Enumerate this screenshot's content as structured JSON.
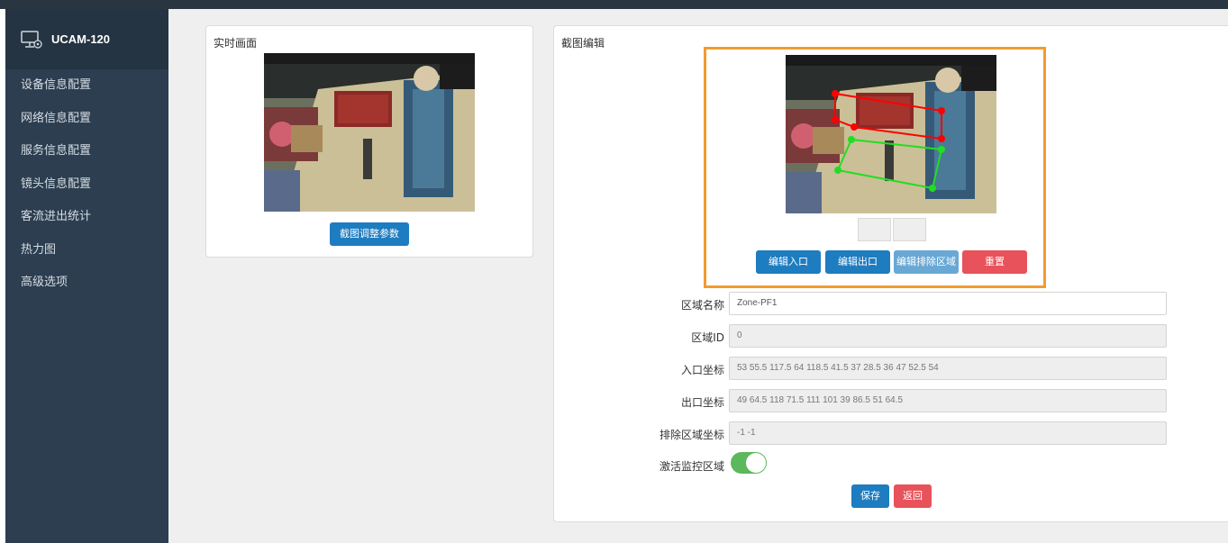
{
  "app": {
    "name": "UCAM-120",
    "icon": "monitor-icon"
  },
  "sidebar": {
    "items": [
      {
        "label": "设备信息配置"
      },
      {
        "label": "网络信息配置"
      },
      {
        "label": "服务信息配置"
      },
      {
        "label": "镜头信息配置"
      },
      {
        "label": "客流进出统计"
      },
      {
        "label": "热力图"
      },
      {
        "label": "高级选项"
      }
    ]
  },
  "live_panel": {
    "title": "实时画面",
    "adjust_button": "截图调整参数"
  },
  "editor": {
    "title": "截图编辑",
    "buttons": {
      "edit_entrance": "编辑入口",
      "edit_exit": "编辑出口",
      "edit_exclude": "编辑排除区域",
      "reset": "重置"
    },
    "fields": {
      "zone_name": {
        "label": "区域名称",
        "value": "Zone-PF1"
      },
      "zone_id": {
        "label": "区域ID",
        "value": "0"
      },
      "entrance_coords": {
        "label": "入口坐标",
        "value": "53 55.5 117.5 64 118.5 41.5 37 28.5 36 47 52.5 54"
      },
      "exit_coords": {
        "label": "出口坐标",
        "value": "49 64.5 118 71.5 111 101 39 86.5 51 64.5"
      },
      "exclude_coords": {
        "label": "排除区域坐标",
        "value": "-1 -1"
      },
      "activate": {
        "label": "激活监控区域",
        "enabled": true
      }
    },
    "save_button": "保存",
    "back_button": "返回"
  },
  "colors": {
    "sidebar_bg": "#2c3e50",
    "primary": "#1e7cc0",
    "danger": "#e8525a",
    "highlight_border": "#f29b2f",
    "toggle_on": "#5cb85c",
    "entrance_zone": "#ff0000",
    "exit_zone": "#22dd22"
  }
}
